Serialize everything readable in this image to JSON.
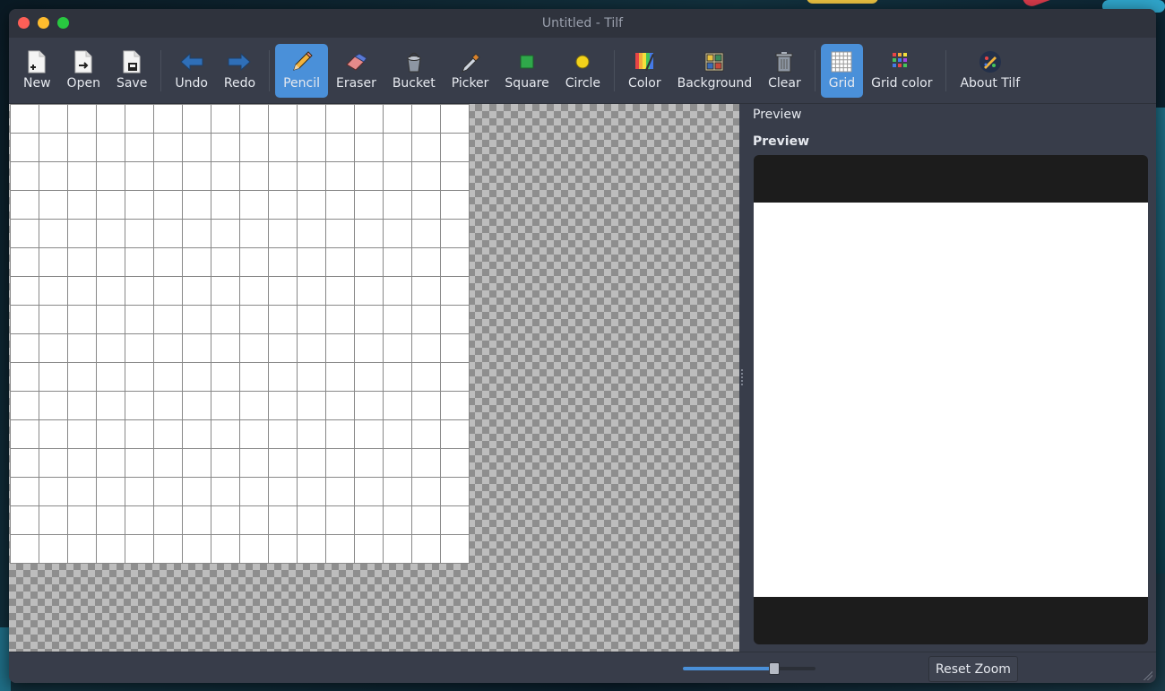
{
  "window": {
    "title": "Untitled - Tilf",
    "buttons": [
      "close",
      "minimize",
      "maximize"
    ]
  },
  "toolbar": {
    "groups": [
      [
        {
          "id": "new",
          "label": "New",
          "icon": "new-file-icon"
        },
        {
          "id": "open",
          "label": "Open",
          "icon": "open-file-icon"
        },
        {
          "id": "save",
          "label": "Save",
          "icon": "save-file-icon"
        }
      ],
      [
        {
          "id": "undo",
          "label": "Undo",
          "icon": "undo-arrow-icon"
        },
        {
          "id": "redo",
          "label": "Redo",
          "icon": "redo-arrow-icon"
        }
      ],
      [
        {
          "id": "pencil",
          "label": "Pencil",
          "icon": "pencil-icon",
          "active": true
        },
        {
          "id": "eraser",
          "label": "Eraser",
          "icon": "eraser-icon"
        },
        {
          "id": "bucket",
          "label": "Bucket",
          "icon": "bucket-icon"
        },
        {
          "id": "picker",
          "label": "Picker",
          "icon": "color-picker-icon"
        },
        {
          "id": "square",
          "label": "Square",
          "icon": "square-icon"
        },
        {
          "id": "circle",
          "label": "Circle",
          "icon": "circle-icon"
        }
      ],
      [
        {
          "id": "color",
          "label": "Color",
          "icon": "color-palette-icon"
        },
        {
          "id": "background",
          "label": "Background",
          "icon": "background-icon"
        },
        {
          "id": "clear",
          "label": "Clear",
          "icon": "trash-icon"
        }
      ],
      [
        {
          "id": "grid",
          "label": "Grid",
          "icon": "grid-icon",
          "active": true
        },
        {
          "id": "grid-color",
          "label": "Grid color",
          "icon": "grid-color-icon"
        }
      ],
      [
        {
          "id": "about",
          "label": "About Tilf",
          "icon": "app-logo-icon"
        }
      ]
    ]
  },
  "canvas": {
    "grid_cells": 16
  },
  "side_panel": {
    "tab_label": "Preview",
    "heading": "Preview"
  },
  "status": {
    "zoom_level": 0.68,
    "reset_label": "Reset Zoom"
  },
  "colors": {
    "accent": "#4a90d9",
    "window_bg": "#383d4a",
    "titlebar_bg": "#2f333d",
    "preview_bg": "#1c1c1c"
  }
}
